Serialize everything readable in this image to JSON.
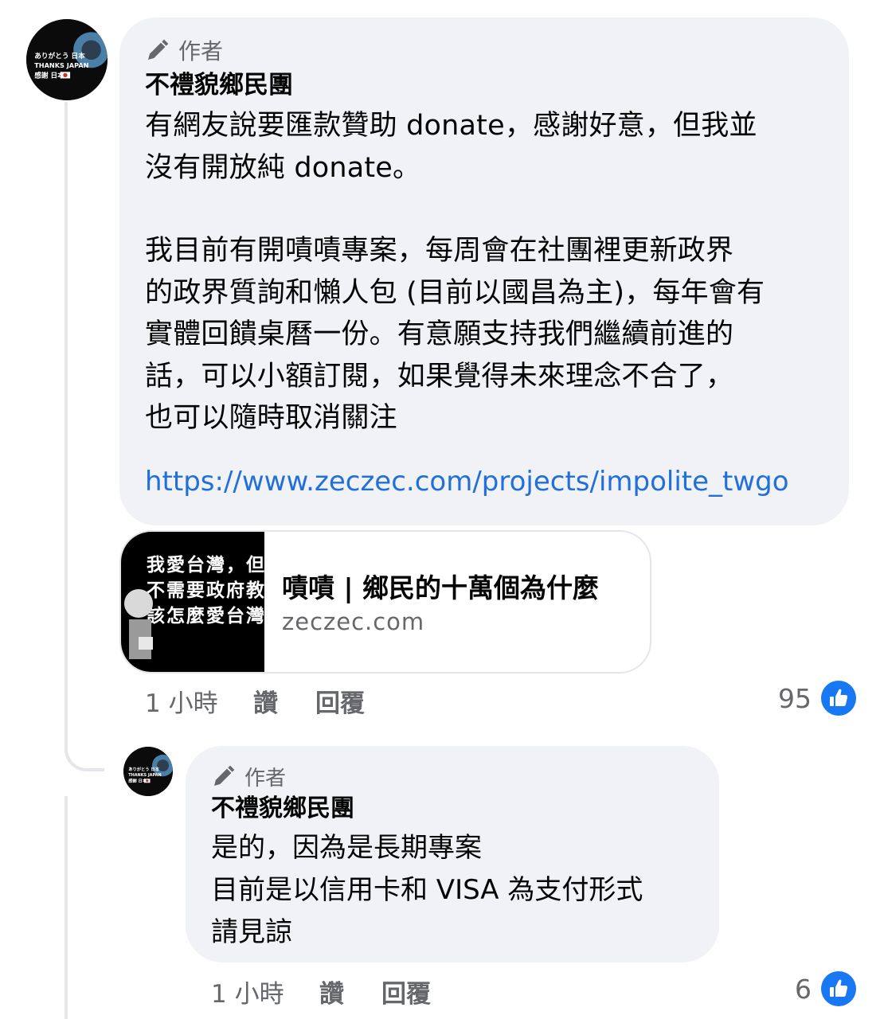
{
  "comments": [
    {
      "author_badge": "作者",
      "author_name": "不禮貌鄉民團",
      "paragraphs": [
        "有網友說要匯款贊助 donate，感謝好意，但我並\n沒有開放純 donate。",
        "我目前有開嘖嘖專案，每周會在社團裡更新政界\n的政界質詢和懶人包 (目前以國昌為主)，每年會有\n實體回饋桌曆一份。有意願支持我們繼續前進的\n話，可以小額訂閱，如果覺得未來理念不合了，\n也可以隨時取消關注"
      ],
      "link": "https://www.zeczec.com/projects/impolite_twgo",
      "preview": {
        "thumb_lines": [
          "我愛台灣，但",
          "不需要政府教",
          "該怎麼愛台灣"
        ],
        "title": "嘖嘖 | 鄉民的十萬個為什麼",
        "domain": "zeczec.com"
      },
      "time": "1 小時",
      "like_label": "讚",
      "reply_label": "回覆",
      "reaction_count": "95",
      "avatar_icon": "avatar-thanks-japan-icon"
    },
    {
      "author_badge": "作者",
      "author_name": "不禮貌鄉民團",
      "paragraphs": [
        "是的，因為是長期專案\n目前是以信用卡和 VISA 為支付形式\n請見諒"
      ],
      "time": "1 小時",
      "like_label": "讚",
      "reply_label": "回覆",
      "reaction_count": "6"
    }
  ],
  "avatar_text": [
    "ありがとう 日本",
    "THANKS JAPAN",
    "感謝 日本"
  ],
  "colors": {
    "bubble": "#f0f2f5",
    "link": "#216fdb",
    "meta": "#65676b",
    "like_blue": "#1877f2",
    "thread": "#e4e6eb"
  }
}
